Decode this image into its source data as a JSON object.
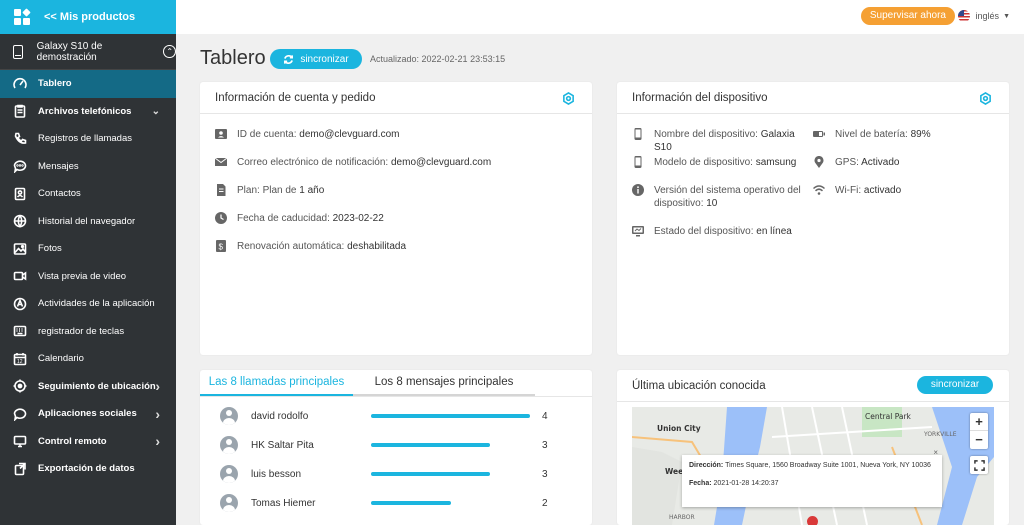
{
  "sidebar": {
    "back_label": "<< Mis productos",
    "device_name": "Galaxy S10 de demostración",
    "items": [
      {
        "label": "Tablero",
        "icon": "gauge-icon",
        "active": true,
        "bold": true
      },
      {
        "label": "Archivos telefónicos",
        "icon": "clipboard-icon",
        "bold": true,
        "expand": "down"
      },
      {
        "label": "Registros de llamadas",
        "icon": "phone-icon"
      },
      {
        "label": "Mensajes",
        "icon": "chat-icon"
      },
      {
        "label": "Contactos",
        "icon": "contacts-icon"
      },
      {
        "label": "Historial del navegador",
        "icon": "globe-icon"
      },
      {
        "label": "Fotos",
        "icon": "image-icon"
      },
      {
        "label": "Vista previa de video",
        "icon": "video-icon"
      },
      {
        "label": "Actividades de la aplicación",
        "icon": "app-icon"
      },
      {
        "label": "registrador de teclas",
        "icon": "keyboard-icon"
      },
      {
        "label": "Calendario",
        "icon": "calendar-icon"
      },
      {
        "label": "Seguimiento de ubicación",
        "icon": "location-icon",
        "bold": true,
        "expand": "right"
      },
      {
        "label": "Aplicaciones sociales",
        "icon": "social-chat-icon",
        "bold": true,
        "expand": "right"
      },
      {
        "label": "Control remoto",
        "icon": "remote-icon",
        "bold": true,
        "expand": "right"
      },
      {
        "label": "Exportación de datos",
        "icon": "export-icon",
        "bold": true
      }
    ]
  },
  "topbar": {
    "supervise_label": "Supervisar ahora",
    "language": "inglés"
  },
  "header": {
    "title": "Tablero",
    "sync_label": "sincronizar",
    "updated": "Actualizado: 2022-02-21 23:53:15"
  },
  "account": {
    "title": "Información de cuenta y pedido",
    "rows": [
      {
        "label": "ID de cuenta: ",
        "value": "demo@clevguard.com",
        "icon": "id-card-icon"
      },
      {
        "label": "Correo electrónico de notificación: ",
        "value": "demo@clevguard.com",
        "icon": "mail-icon"
      },
      {
        "label": "Plan: Plan de ",
        "value": "1 año",
        "icon": "document-icon"
      },
      {
        "label": "Fecha de caducidad: ",
        "value": "2023-02-22",
        "icon": "clock-icon"
      },
      {
        "label": "Renovación automática: ",
        "value": "deshabilitada",
        "icon": "dollar-icon"
      }
    ]
  },
  "device": {
    "title": "Información del dispositivo",
    "left": [
      {
        "label": "Nombre del dispositivo: ",
        "value": "Galaxia S10",
        "icon": "phone-device-icon"
      },
      {
        "label": "Modelo de dispositivo: ",
        "value": "samsung",
        "icon": "phone-device-icon"
      },
      {
        "label": "Versión del sistema operativo del dispositivo: ",
        "value": "10",
        "icon": "info-icon"
      },
      {
        "label": "Estado del dispositivo: ",
        "value": "en línea",
        "icon": "monitor-icon"
      }
    ],
    "right": [
      {
        "label": "Nivel de batería: ",
        "value": "89%",
        "icon": "battery-icon"
      },
      {
        "label": "GPS: ",
        "value": "Activado",
        "icon": "gps-pin-icon"
      },
      {
        "label": "Wi-Fi: ",
        "value": "activado",
        "icon": "wifi-icon"
      }
    ]
  },
  "top_lists": {
    "tab_calls": "Las 8 llamadas principales",
    "tab_messages": "Los 8 mensajes principales",
    "calls": [
      {
        "name": "david rodolfo",
        "count": "4",
        "fraction": 1.0
      },
      {
        "name": "HK Saltar Pita",
        "count": "3",
        "fraction": 0.75
      },
      {
        "name": "luis besson",
        "count": "3",
        "fraction": 0.75
      },
      {
        "name": "Tomas Hiemer",
        "count": "2",
        "fraction": 0.5
      }
    ]
  },
  "location": {
    "title": "Última ubicación conocida",
    "sync_label": "sincronizar",
    "popup_address_label": "Dirección:",
    "popup_address": "Times Square, 1560 Broadway Suite 1001, Nueva York, NY 10036",
    "popup_date_label": "Fecha:",
    "popup_date": "2021-01-28 14:20:37",
    "map_labels": [
      "Union City",
      "Central Park",
      "YORKVILLE",
      "Wee",
      "HARBOR"
    ],
    "colors": {
      "water": "#9cc0f9",
      "land": "#e8eae6",
      "park": "#c8e6c4"
    }
  }
}
